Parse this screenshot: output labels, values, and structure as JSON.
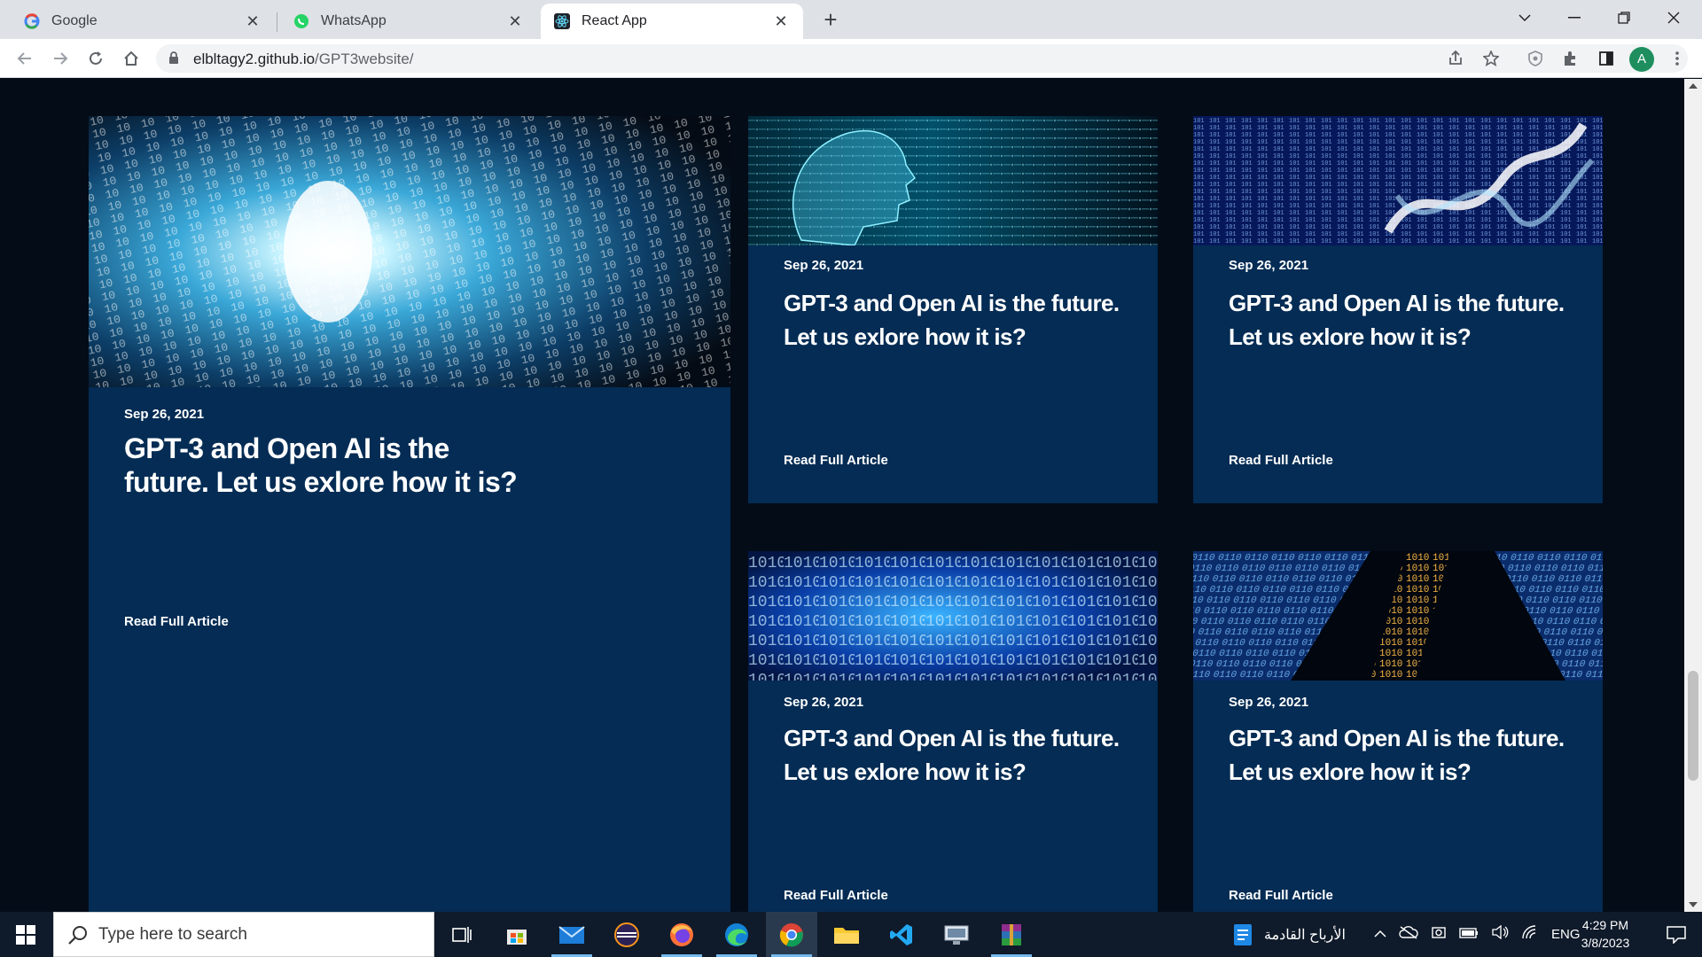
{
  "browser": {
    "tabs": [
      {
        "title": "Google",
        "favicon": "google-icon",
        "active": false
      },
      {
        "title": "WhatsApp",
        "favicon": "whatsapp-icon",
        "active": false
      },
      {
        "title": "React App",
        "favicon": "react-icon",
        "active": true
      }
    ],
    "url_host": "elbltagy2.github.io",
    "url_path": "/GPT3website/",
    "profile_initial": "A"
  },
  "blog": {
    "featured": {
      "date": "Sep 26, 2021",
      "title": "GPT-3 and Open AI is the future. Let us exlore how it is?",
      "link": "Read Full Article",
      "image": "binary-tunnel-image"
    },
    "posts": [
      {
        "date": "Sep 26, 2021",
        "title": "GPT-3 and Open AI is the future. Let us exlore how it is?",
        "link": "Read Full Article",
        "image": "ai-head-image"
      },
      {
        "date": "Sep 26, 2021",
        "title": "GPT-3 and Open AI is the future. Let us exlore how it is?",
        "link": "Read Full Article",
        "image": "binary-dna-image"
      },
      {
        "date": "Sep 26, 2021",
        "title": "GPT-3 and Open AI is the future. Let us exlore how it is?",
        "link": "Read Full Article",
        "image": "binary-blue-image"
      },
      {
        "date": "Sep 26, 2021",
        "title": "GPT-3 and Open AI is the future. Let us exlore how it is?",
        "link": "Read Full Article",
        "image": "binary-gold-image"
      }
    ]
  },
  "taskbar": {
    "search_placeholder": "Type here to search",
    "weather_text": "الأرباح القادمة",
    "language": "ENG",
    "time": "4:29 PM",
    "date": "3/8/2023"
  },
  "colors": {
    "page_bg": "#040c18",
    "card_bg": "#042c54",
    "text": "#ffffff"
  }
}
